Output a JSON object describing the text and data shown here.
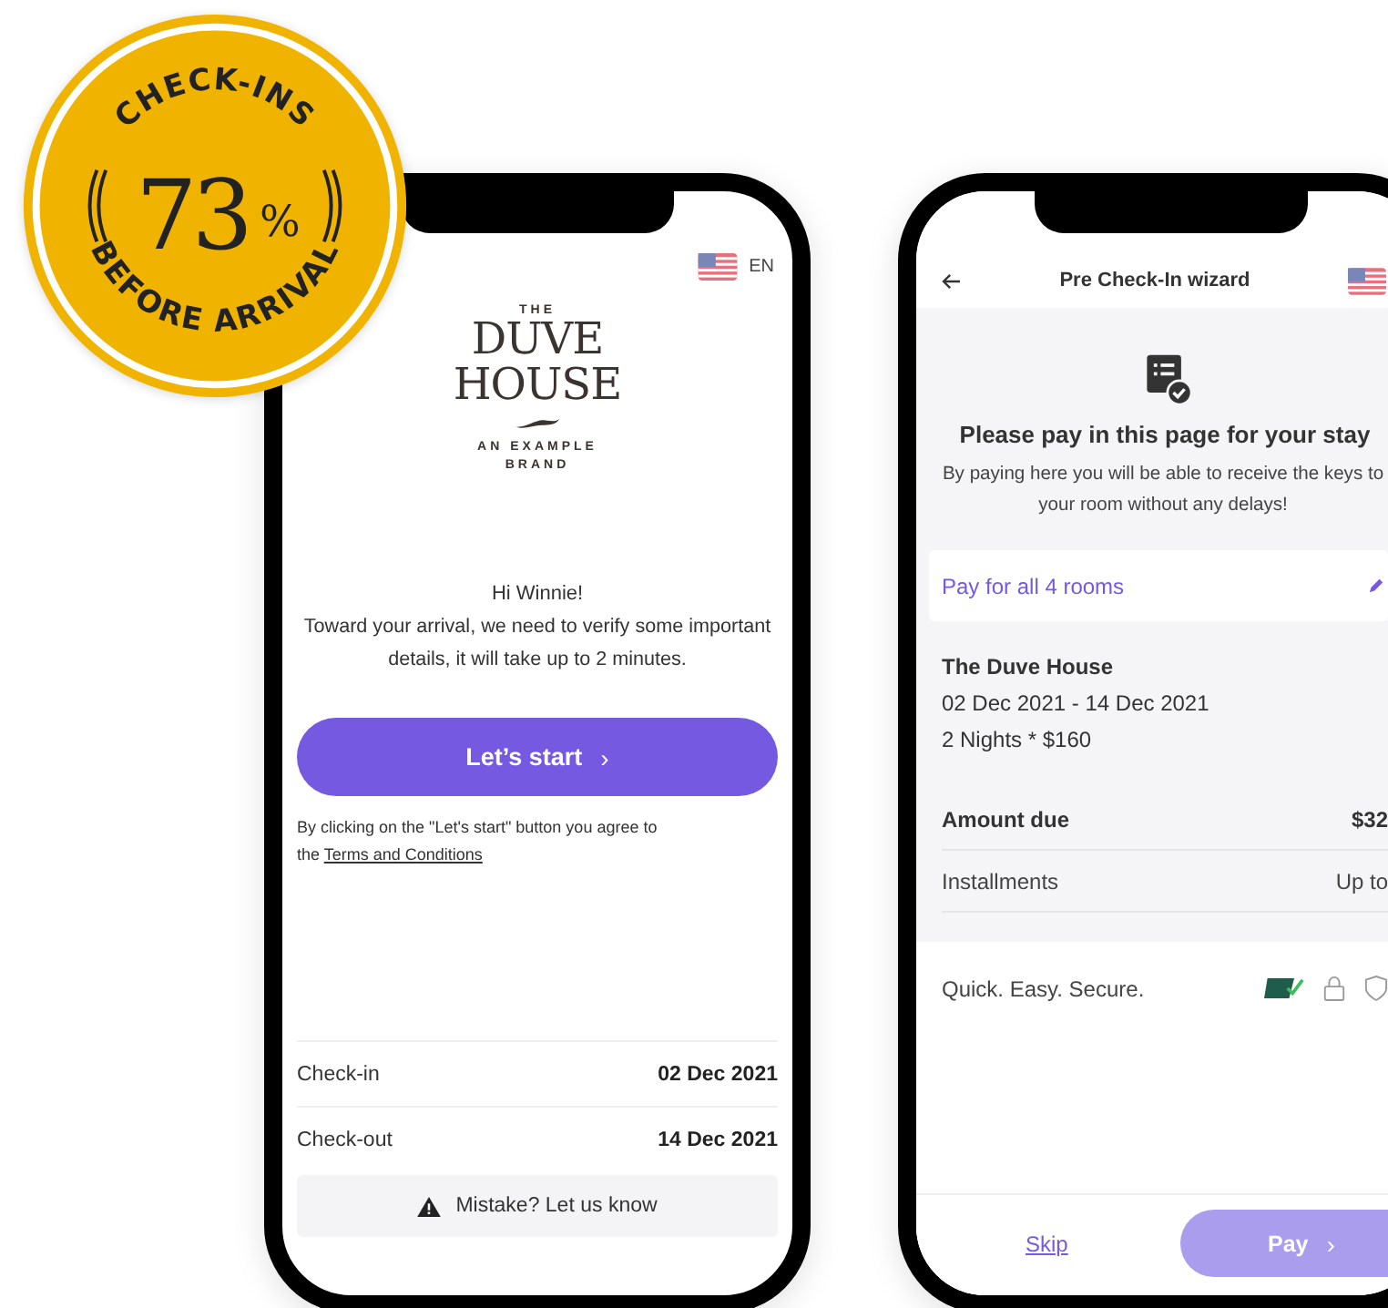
{
  "badge": {
    "top_text": "CHECK-INS",
    "value": "73",
    "unit": "%",
    "bottom_text": "BEFORE ARRIVAL"
  },
  "welcome_screen": {
    "language": "EN",
    "logo": {
      "top": "THE",
      "name_lines": [
        "DUVE",
        "HOUSE"
      ],
      "tagline_lines": [
        "AN EXAMPLE",
        "BRAND"
      ]
    },
    "greeting": "Hi Winnie!",
    "message": "Toward your arrival, we need to verify some important details, it will take up to 2 minutes.",
    "start_button": {
      "label": "Let’s start",
      "chevron": "›"
    },
    "terms": {
      "text": "By clicking on the \"Let's start\" button you agree to the",
      "link": "Terms and Conditions"
    },
    "details": [
      {
        "label": "Check-in",
        "value": "02 Dec 2021"
      },
      {
        "label": "Check-out",
        "value": "14 Dec 2021"
      }
    ],
    "mistake_link": "Mistake? Let us know"
  },
  "payment_screen": {
    "title": "Pre Check-In wizard",
    "heading": "Please pay in this page for your stay",
    "subtitle": "By paying here you will be able to receive the keys to your room without any delays!",
    "rooms_option": "Pay for all 4 rooms",
    "property": "The Duve House",
    "dates": "02 Dec 2021 - 14 Dec 2021",
    "nights": "2 Nights * $160",
    "summary": [
      {
        "label": "Amount due",
        "value": "$32",
        "kind": "total"
      },
      {
        "label": "Installments",
        "value": "Up to",
        "kind": "plain"
      }
    ],
    "security_note": "Quick. Easy. Secure.",
    "skip": "Skip",
    "pay_button": {
      "label": "Pay",
      "chevron": "›",
      "disabled": true
    }
  }
}
